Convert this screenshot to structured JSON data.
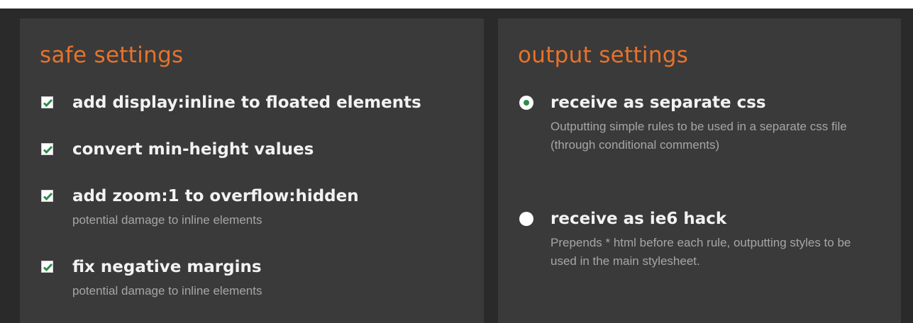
{
  "safe_settings": {
    "title": "safe settings",
    "options": [
      {
        "label": "add display:inline to floated elements",
        "checked": true,
        "description": ""
      },
      {
        "label": "convert min-height values",
        "checked": true,
        "description": ""
      },
      {
        "label": "add zoom:1 to overflow:hidden",
        "checked": true,
        "description": "potential damage to inline elements"
      },
      {
        "label": "fix negative margins",
        "checked": true,
        "description": "potential damage to inline elements"
      }
    ]
  },
  "output_settings": {
    "title": "output settings",
    "options": [
      {
        "label": "receive as separate css",
        "selected": true,
        "description": "Outputting simple rules to be used in a separate css file (through conditional comments)"
      },
      {
        "label": "receive as ie6 hack",
        "selected": false,
        "description": "Prepends * html before each rule, outputting styles to be used in the main stylesheet."
      }
    ]
  },
  "colors": {
    "background": "#2a2a2a",
    "panel": "#3a3a3a",
    "heading": "#e8722a",
    "label": "#f2f2f2",
    "description": "#a6a6a6",
    "check": "#2e8b4a"
  }
}
